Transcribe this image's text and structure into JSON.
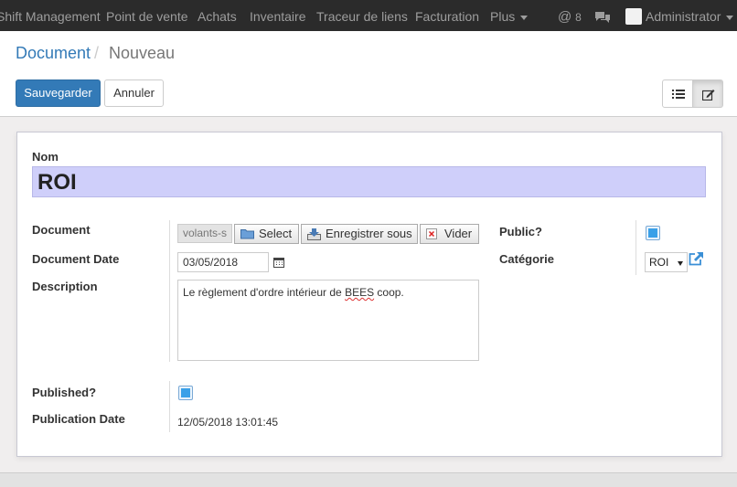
{
  "navbar": {
    "items": [
      "Shift Management",
      "Point de vente",
      "Achats",
      "Inventaire",
      "Traceur de liens",
      "Facturation",
      "Plus"
    ],
    "mentions_count": "8",
    "user": "Administrator"
  },
  "breadcrumb": {
    "parent": "Document",
    "separator": "/",
    "current": "Nouveau"
  },
  "buttons": {
    "save": "Sauvegarder",
    "discard": "Annuler"
  },
  "form": {
    "name_label": "Nom",
    "name_value": "ROI",
    "document_label": "Document",
    "file_name": "volants-s",
    "file_select": "Select",
    "file_save_as": "Enregistrer sous",
    "file_clear": "Vider",
    "date_label": "Document Date",
    "date_value": "03/05/2018",
    "description_label": "Description",
    "description_value_before": "Le règlement d'ordre intérieur de ",
    "description_value_misspelled": "BEES",
    "description_value_after": " coop.",
    "public_label": "Public?",
    "public_checked": true,
    "category_label": "Catégorie",
    "category_value": "ROI",
    "published_label": "Published?",
    "published_checked": true,
    "publication_date_label": "Publication Date",
    "publication_date_value": "12/05/2018 13:01:45"
  },
  "colors": {
    "primary": "#337ab7",
    "navbar": "#2b2b2b",
    "required_field": "#cfcffa"
  }
}
